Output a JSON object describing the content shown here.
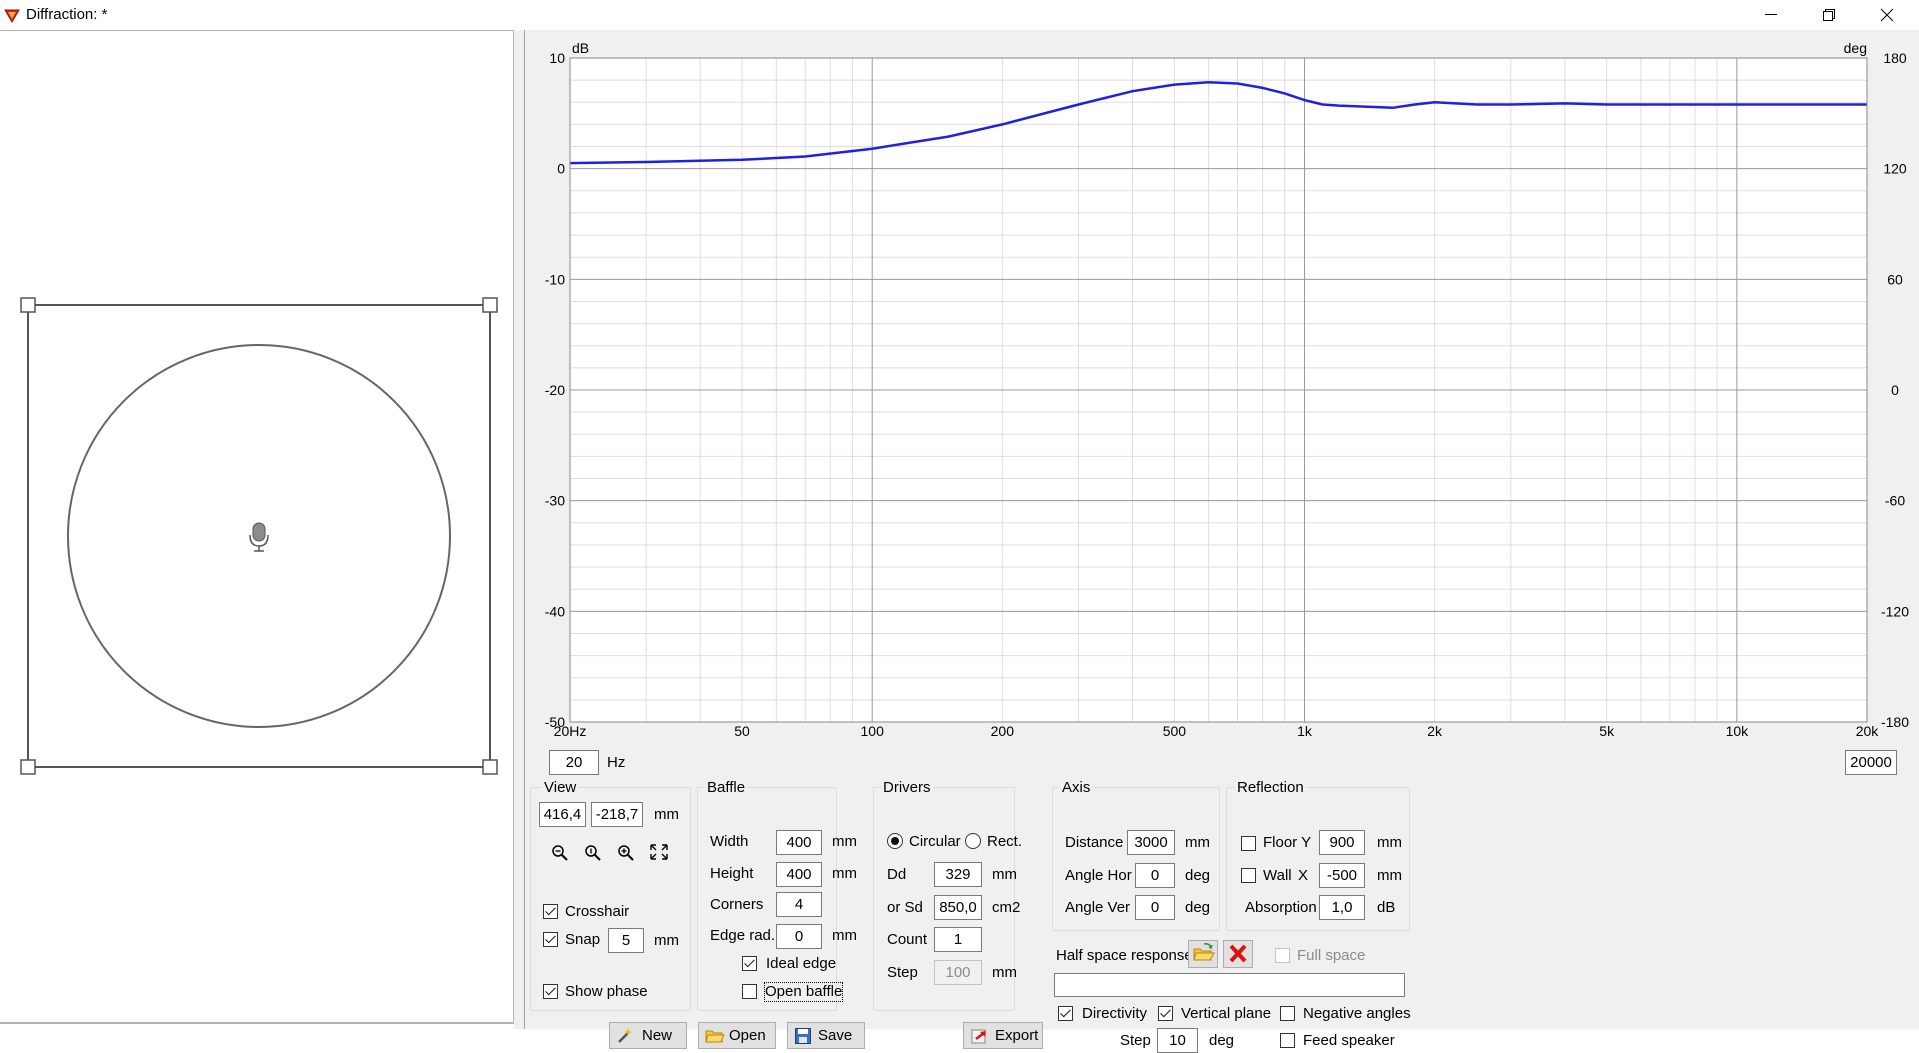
{
  "window": {
    "title": "Diffraction: *"
  },
  "graph": {
    "left_axis_unit": "dB",
    "right_axis_unit": "deg",
    "left_ticks": [
      "10",
      "0",
      "-10",
      "-20",
      "-30",
      "-40",
      "-50"
    ],
    "right_ticks": [
      "180",
      "120",
      "60",
      "0",
      "-60",
      "-120",
      "-180"
    ],
    "x_ticks": [
      "20Hz",
      "50",
      "100",
      "200",
      "500",
      "1k",
      "2k",
      "5k",
      "10k",
      "20k"
    ],
    "freq_min": "20",
    "freq_min_unit": "Hz",
    "freq_max": "20000",
    "colors": {
      "curve": "#1f1fe6",
      "grid_major": "#999999",
      "grid_minor": "#dddddd"
    }
  },
  "chart_data": {
    "type": "line",
    "xscale": "log",
    "xlim": [
      20,
      20000
    ],
    "ylim": [
      -50,
      10
    ],
    "y2lim": [
      -180,
      180
    ],
    "xlabel": "",
    "ylabel": "dB",
    "y2label": "deg",
    "series": [
      {
        "x": [
          20,
          30,
          50,
          70,
          100,
          150,
          200,
          300,
          400,
          500,
          600,
          700,
          800,
          900,
          1000,
          1100,
          1200,
          1400,
          1600,
          1800,
          2000,
          2500,
          3000,
          4000,
          5000,
          7000,
          10000,
          15000,
          20000
        ],
        "values": [
          0.5,
          0.6,
          0.8,
          1.1,
          1.8,
          2.9,
          4.0,
          5.8,
          7.0,
          7.6,
          7.8,
          7.7,
          7.3,
          6.8,
          6.2,
          5.8,
          5.7,
          5.6,
          5.5,
          5.8,
          6.0,
          5.8,
          5.8,
          5.9,
          5.8,
          5.8,
          5.8,
          5.8,
          5.8
        ]
      }
    ]
  },
  "view": {
    "title": "View",
    "x": "416,4",
    "y": "-218,7",
    "unit": "mm",
    "crosshair_label": "Crosshair",
    "snap_label": "Snap",
    "snap_value": "5",
    "snap_unit": "mm",
    "show_phase_label": "Show phase"
  },
  "baffle": {
    "title": "Baffle",
    "width_label": "Width",
    "width_value": "400",
    "width_unit": "mm",
    "height_label": "Height",
    "height_value": "400",
    "height_unit": "mm",
    "corners_label": "Corners",
    "corners_value": "4",
    "edge_rad_label": "Edge rad.",
    "edge_rad_value": "0",
    "edge_rad_unit": "mm",
    "ideal_edge_label": "Ideal edge",
    "open_baffle_label": "Open baffle"
  },
  "drivers": {
    "title": "Drivers",
    "circular_label": "Circular",
    "rect_label": "Rect.",
    "dd_label": "Dd",
    "dd_value": "329",
    "dd_unit": "mm",
    "sd_label": "or Sd",
    "sd_value": "850,0",
    "sd_unit": "cm2",
    "count_label": "Count",
    "count_value": "1",
    "step_label": "Step",
    "step_value": "100",
    "step_unit": "mm"
  },
  "axis": {
    "title": "Axis",
    "distance_label": "Distance",
    "distance_value": "3000",
    "distance_unit": "mm",
    "angle_hor_label": "Angle Hor",
    "angle_hor_value": "0",
    "angle_hor_unit": "deg",
    "angle_ver_label": "Angle Ver",
    "angle_ver_value": "0",
    "angle_ver_unit": "deg"
  },
  "reflection": {
    "title": "Reflection",
    "floor_label": "Floor Y",
    "floor_value": "900",
    "floor_unit": "mm",
    "wall_label": "Wall",
    "wall_axis": "X",
    "wall_value": "-500",
    "wall_unit": "mm",
    "absorption_label": "Absorption",
    "absorption_value": "1,0",
    "absorption_unit": "dB"
  },
  "half_space": {
    "label": "Half space response",
    "full_space_label": "Full space",
    "path_value": ""
  },
  "directivity": {
    "directivity_label": "Directivity",
    "vertical_plane_label": "Vertical plane",
    "negative_angles_label": "Negative angles",
    "step_label": "Step",
    "step_value": "10",
    "step_unit": "deg",
    "feed_speaker_label": "Feed speaker"
  },
  "buttons": {
    "new": "New",
    "open": "Open",
    "save": "Save",
    "export": "Export"
  }
}
